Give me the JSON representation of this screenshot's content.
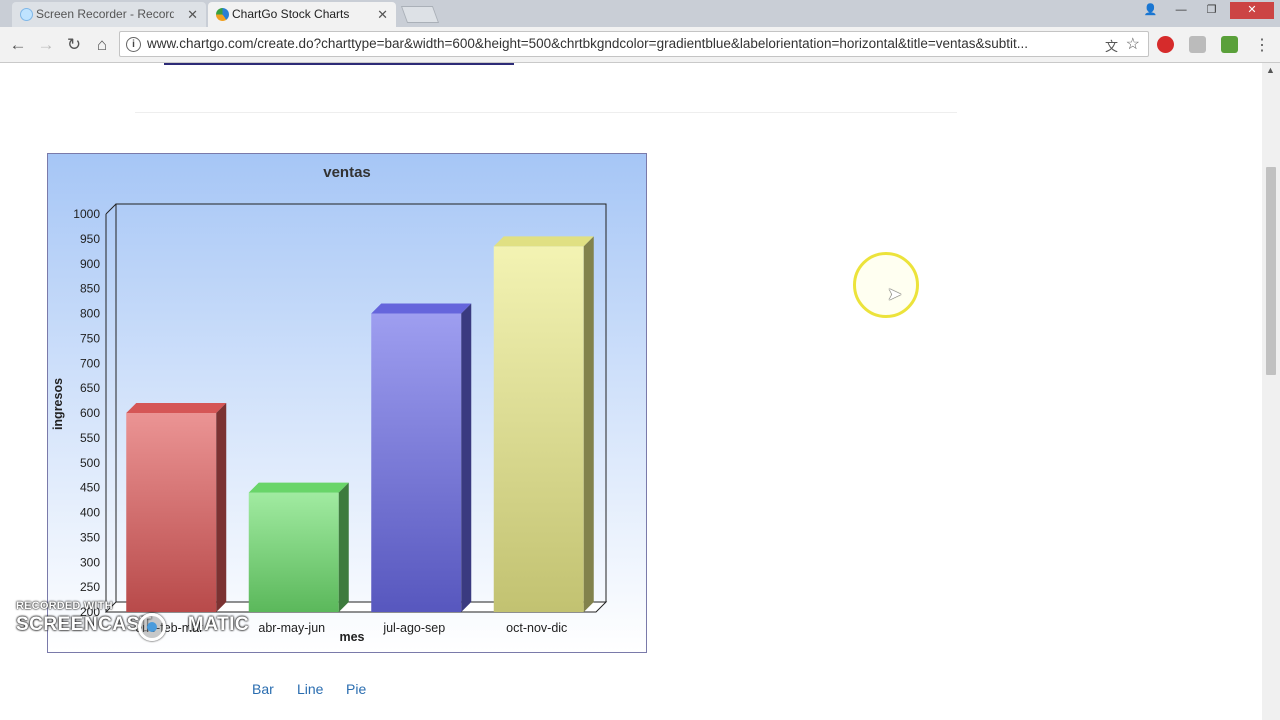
{
  "browser": {
    "tabs": [
      {
        "title": "Screen Recorder - Record",
        "close": "✕"
      },
      {
        "title": "ChartGo Stock Charts",
        "close": "✕"
      }
    ],
    "url": "www.chartgo.com/create.do?charttype=bar&width=600&height=500&chrtbkgndcolor=gradientblue&labelorientation=horizontal&title=ventas&subtit...",
    "icons": {
      "back": "back-arrow-icon",
      "forward": "forward-arrow-icon",
      "reload": "reload-icon",
      "home": "home-icon",
      "info": "info-icon",
      "translate": "translate-icon",
      "star": "star-icon",
      "menu": "menu-icon"
    }
  },
  "chart_data": {
    "type": "bar",
    "title": "ventas",
    "xlabel": "mes",
    "ylabel": "ingresos",
    "categories": [
      "ene-feb-mar",
      "abr-may-jun",
      "jul-ago-sep",
      "oct-nov-dic"
    ],
    "values": [
      600,
      440,
      800,
      935
    ],
    "ylim": [
      200,
      1000
    ],
    "yticks": [
      200,
      250,
      300,
      350,
      400,
      450,
      500,
      550,
      600,
      650,
      700,
      750,
      800,
      850,
      900,
      950,
      1000
    ],
    "colors": [
      "#e05a5a",
      "#6fe06f",
      "#6a6ae8",
      "#ecec8a"
    ],
    "background": "gradient-blue",
    "grid": false,
    "style": "3d"
  },
  "page": {
    "links": [
      "Bar",
      "Line",
      "Pie"
    ]
  },
  "watermark": {
    "small": "RECORDED WITH",
    "big": "SCREENCAST",
    "big2": "MATIC"
  }
}
